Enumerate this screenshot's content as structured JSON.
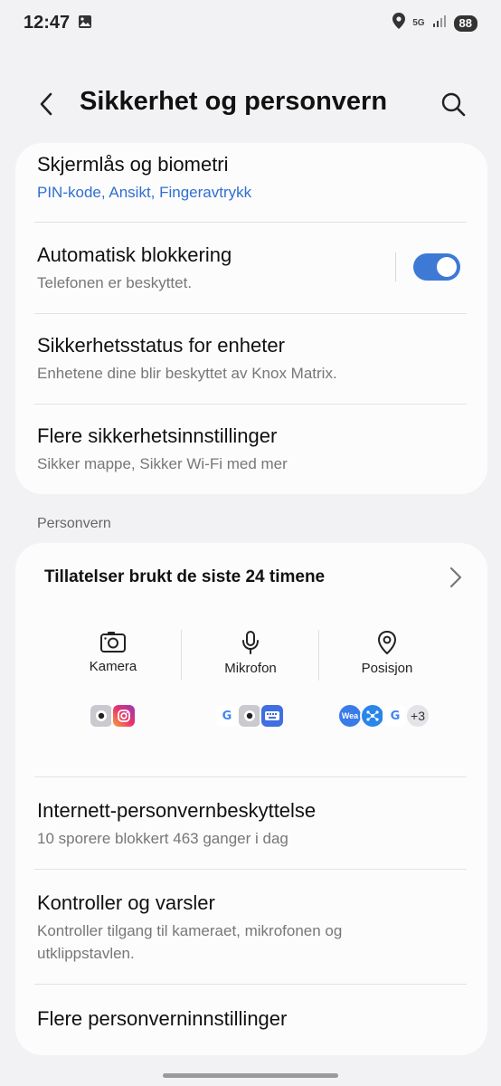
{
  "status": {
    "time": "12:47",
    "network": "5G",
    "battery": "88"
  },
  "header": {
    "title": "Sikkerhet og personvern"
  },
  "security": {
    "items": [
      {
        "title": "Skjermlås og biometri",
        "subtitle": "PIN-kode, Ansikt, Fingeravtrykk"
      },
      {
        "title": "Automatisk blokkering",
        "subtitle": "Telefonen er beskyttet.",
        "toggle_on": true
      },
      {
        "title": "Sikkerhetsstatus for enheter",
        "subtitle": "Enhetene dine blir beskyttet av Knox Matrix."
      },
      {
        "title": "Flere sikkerhetsinnstillinger",
        "subtitle": "Sikker mappe, Sikker Wi-Fi med mer"
      }
    ]
  },
  "privacy": {
    "section_label": "Personvern",
    "permissions_title": "Tillatelser brukt de siste 24 timene",
    "permissions": [
      {
        "label": "Kamera",
        "icon": "camera-icon"
      },
      {
        "label": "Mikrofon",
        "icon": "microphone-icon"
      },
      {
        "label": "Posisjon",
        "icon": "location-icon"
      }
    ],
    "more_apps": "+3",
    "weather_app_label": "Wea",
    "google_letter": "G",
    "items": [
      {
        "title": "Internett-personvernbeskyttelse",
        "subtitle": "10 sporere blokkert 463 ganger i dag"
      },
      {
        "title": "Kontroller og varsler",
        "subtitle_line1": "Kontroller tilgang til kameraet, mikrofonen og",
        "subtitle_line2": "utklippstavlen."
      },
      {
        "title": "Flere personverninnstillinger"
      }
    ]
  },
  "colors": {
    "accent": "#3e79d6",
    "link": "#2f6fd0"
  }
}
